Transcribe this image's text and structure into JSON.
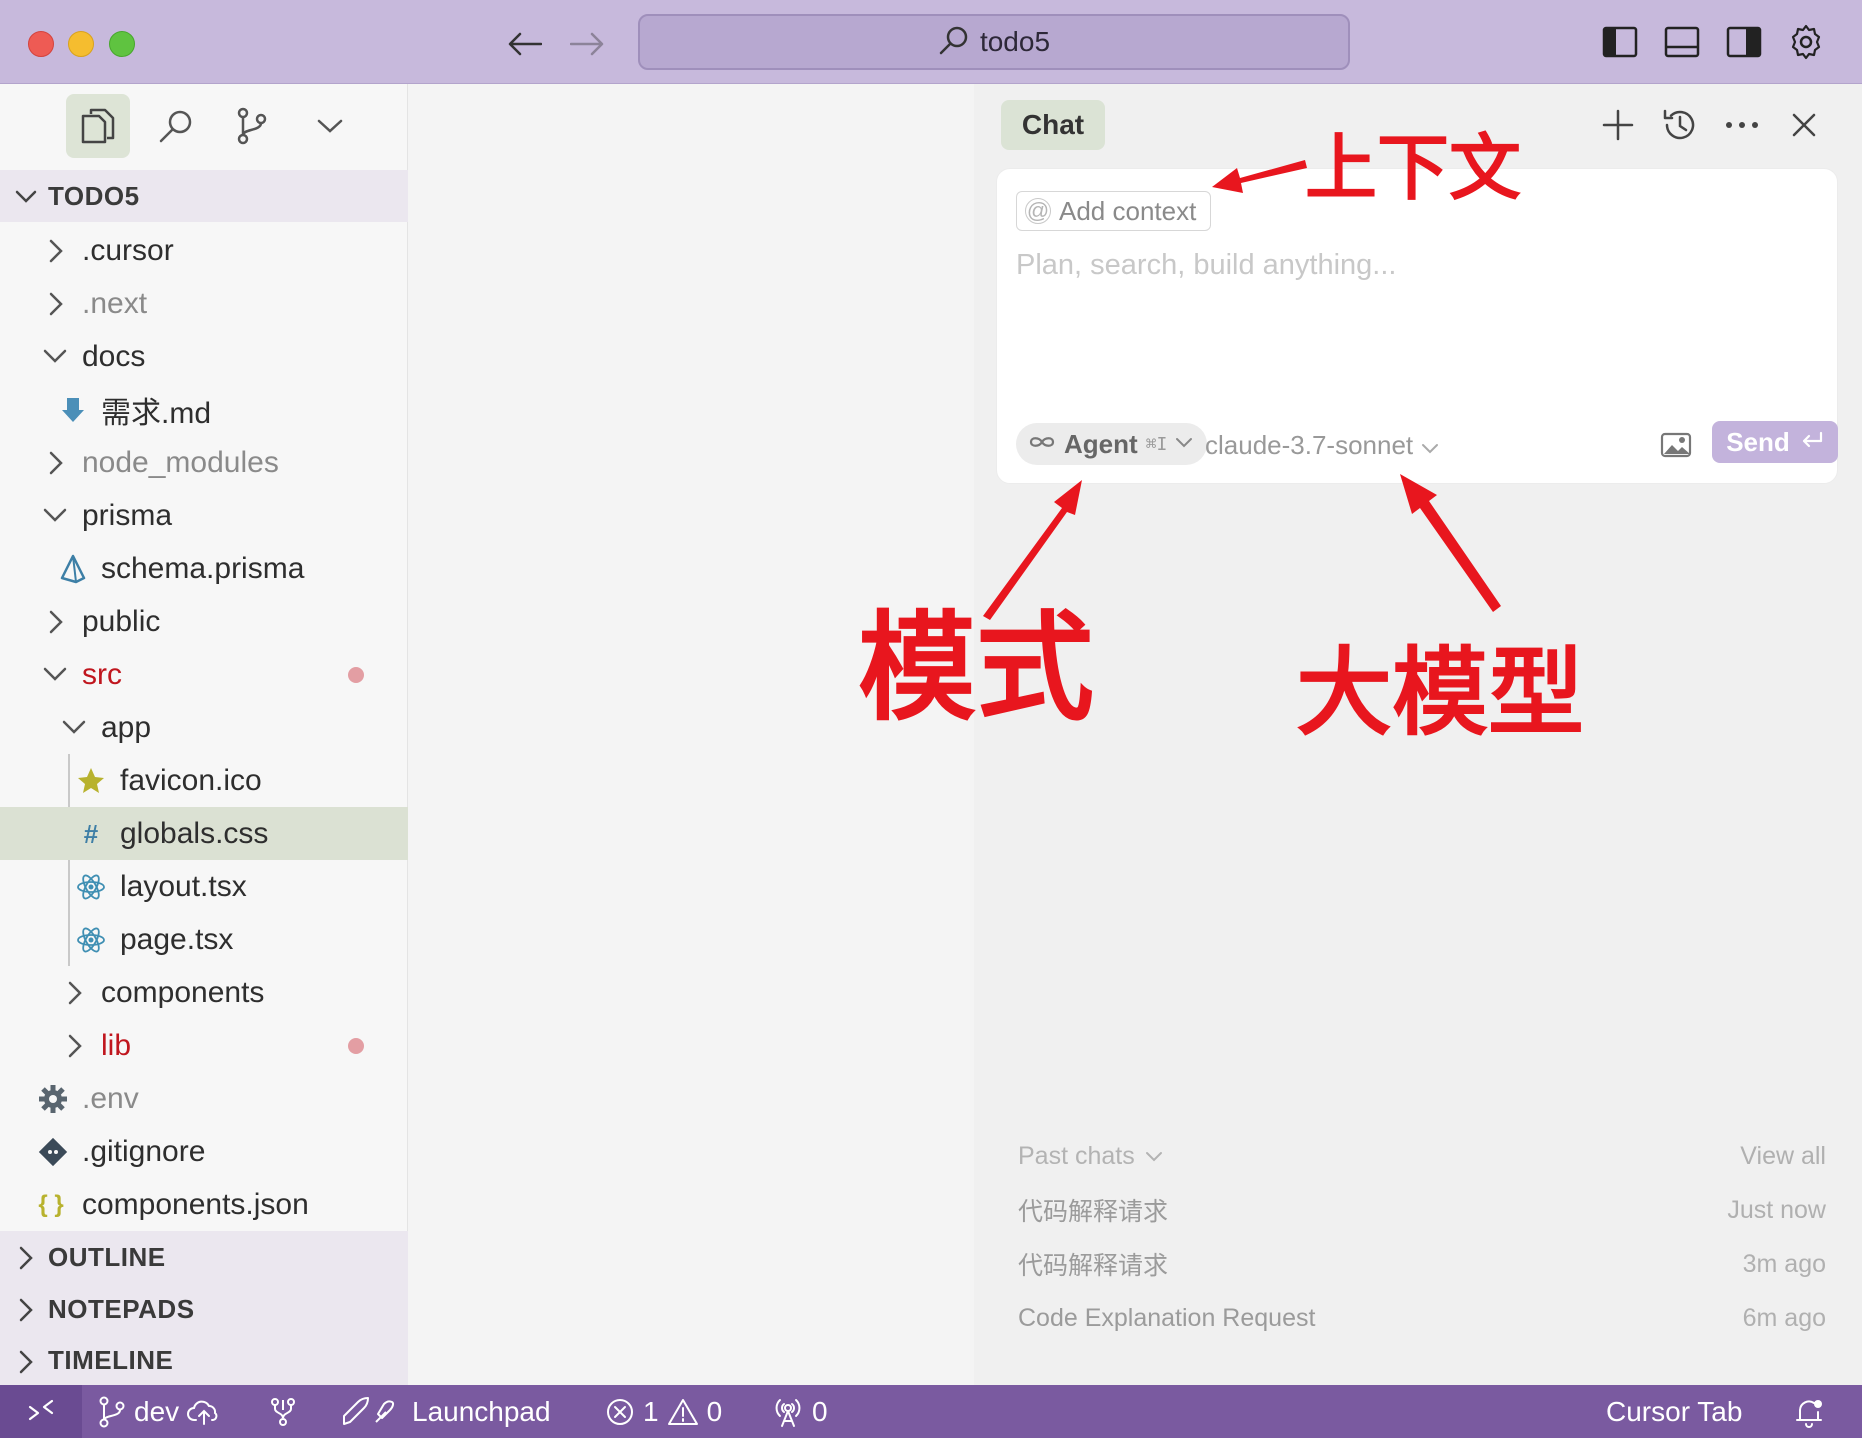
{
  "window": {
    "title": "todo5"
  },
  "sidebar": {
    "root_label": "TODO5",
    "tree": [
      {
        "label": ".cursor"
      },
      {
        "label": ".next"
      },
      {
        "label": "docs"
      },
      {
        "label": "需求.md"
      },
      {
        "label": "node_modules"
      },
      {
        "label": "prisma"
      },
      {
        "label": "schema.prisma"
      },
      {
        "label": "public"
      },
      {
        "label": "src"
      },
      {
        "label": "app"
      },
      {
        "label": "favicon.ico"
      },
      {
        "label": "globals.css"
      },
      {
        "label": "layout.tsx"
      },
      {
        "label": "page.tsx"
      },
      {
        "label": "components"
      },
      {
        "label": "lib"
      },
      {
        "label": ".env"
      },
      {
        "label": ".gitignore"
      },
      {
        "label": "components.json"
      }
    ],
    "sections": [
      "OUTLINE",
      "NOTEPADS",
      "TIMELINE"
    ]
  },
  "chat": {
    "tab_label": "Chat",
    "add_context": "Add context",
    "placeholder": "Plan, search, build anything...",
    "mode_label": "Agent",
    "mode_shortcut": "⌘I",
    "model": "claude-3.7-sonnet",
    "send_label": "Send",
    "past_chats_label": "Past chats",
    "view_all": "View all",
    "history": [
      {
        "title": "代码解释请求",
        "time": "Just now"
      },
      {
        "title": "代码解释请求",
        "time": "3m ago"
      },
      {
        "title": "Code Explanation Request",
        "time": "6m ago"
      }
    ]
  },
  "annotations": {
    "context": "上下文",
    "mode": "模式",
    "model": "大模型",
    "color": "#e8161e"
  },
  "statusbar": {
    "branch": "dev",
    "launchpad": "Launchpad",
    "errors": "1",
    "warnings": "0",
    "ports": "0",
    "cursor_tab": "Cursor Tab"
  },
  "colors": {
    "titlebar": "#c7b9dc",
    "statusbar": "#7a5aa0",
    "modified": "#c0161e",
    "send_button": "#c3b3dc"
  }
}
